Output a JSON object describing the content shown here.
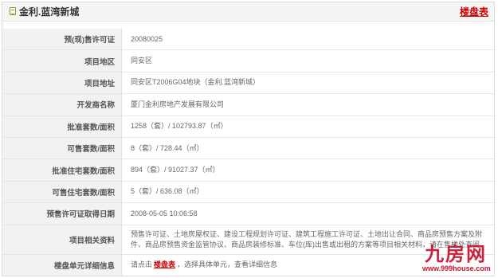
{
  "header": {
    "icon": "document-icon",
    "title": "金利.蓝湾新城",
    "link_label": "楼盘表"
  },
  "rows": [
    {
      "label": "预(现)售许可证",
      "value": "20080025"
    },
    {
      "label": "项目地区",
      "value": "同安区"
    },
    {
      "label": "项目地址",
      "value": "同安区T2006G04地块（金利.蓝湾新城）"
    },
    {
      "label": "开发商名称",
      "value": "厦门金利房地产发展有限公司"
    },
    {
      "label": "批准套数/面积",
      "value": "1258（套）/ 102793.87（㎡）"
    },
    {
      "label": "可售套数/面积",
      "value": "8（套）/ 728.44（㎡）"
    },
    {
      "label": "批准住宅套数/面积",
      "value": "894（套）/ 91027.37（㎡）"
    },
    {
      "label": "可售住宅套数/面积",
      "value": "5（套）/ 636.08（㎡）"
    },
    {
      "label": "预售许可证取得日期",
      "value": "2008-05-05 10:06:58"
    },
    {
      "label": "项目相关资料",
      "value": "预售许可证、土地房屋权证、建设工程规划许可证、建筑工程施工许可证、土地出让合同、商品房预售方案及附件、商品房预售资金监管协议、商品房装修标准、车位(库)出售或出租的方案等项目相关材料，请在售楼处查阅。"
    }
  ],
  "last_row": {
    "label": "楼盘单元详细信息",
    "prefix": "请点击",
    "link": "楼盘表",
    "suffix": "，选择具体单元，查看详细信息"
  },
  "watermark": {
    "logo": "九房网",
    "url": "www.999house.com"
  },
  "colors": {
    "accent": "#cc0000",
    "label_bg": "#f2f2f2",
    "header_bg": "#f5f5f5",
    "icon_green": "#7aa83a"
  }
}
